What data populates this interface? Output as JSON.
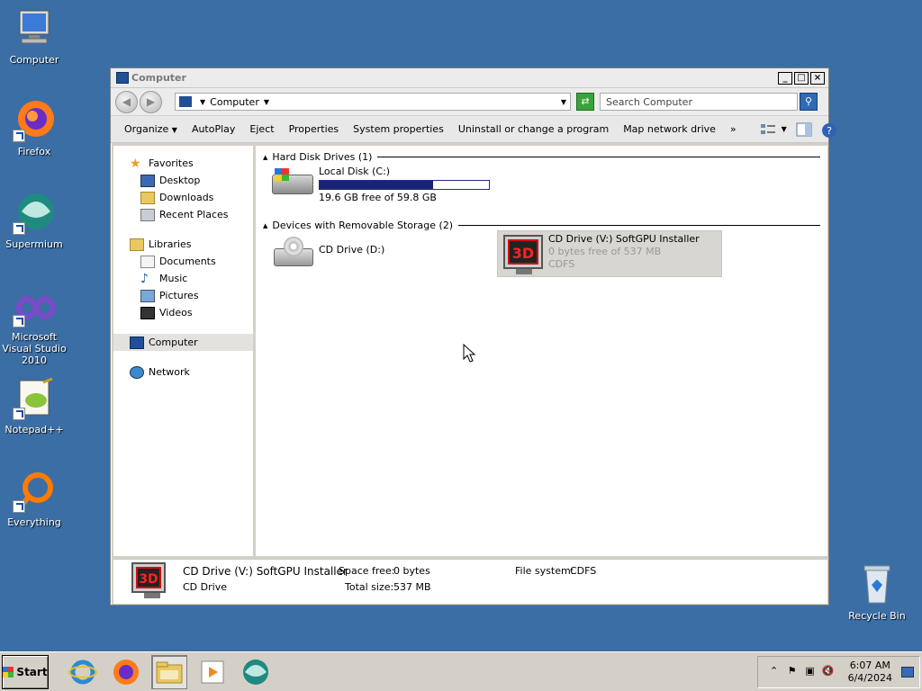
{
  "desktop": {
    "icons": [
      {
        "label": "Computer"
      },
      {
        "label": "Firefox"
      },
      {
        "label": "Supermium"
      },
      {
        "label": "Microsoft Visual Studio 2010"
      },
      {
        "label": "Notepad++"
      },
      {
        "label": "Everything"
      },
      {
        "label": "Recycle Bin"
      }
    ]
  },
  "window": {
    "title": "Computer",
    "address": {
      "location": "Computer"
    },
    "search": {
      "placeholder": "Search Computer"
    },
    "toolbar": {
      "organize": "Organize",
      "autoplay": "AutoPlay",
      "eject": "Eject",
      "properties": "Properties",
      "system_properties": "System properties",
      "uninstall": "Uninstall or change a program",
      "map_drive": "Map network drive",
      "more": "»"
    },
    "nav": {
      "favorites": "Favorites",
      "desktop": "Desktop",
      "downloads": "Downloads",
      "recent": "Recent Places",
      "libraries": "Libraries",
      "documents": "Documents",
      "music": "Music",
      "pictures": "Pictures",
      "videos": "Videos",
      "computer": "Computer",
      "network": "Network"
    },
    "groups": {
      "hdd": "Hard Disk Drives (1)",
      "removable": "Devices with Removable Storage (2)"
    },
    "drives": {
      "c": {
        "name": "Local Disk (C:)",
        "free": "19.6 GB free of 59.8 GB",
        "used_fraction": 0.672
      },
      "d": {
        "name": "CD Drive (D:)"
      },
      "v": {
        "name": "CD Drive (V:) SoftGPU Installer",
        "free": "0 bytes free of 537 MB",
        "fs": "CDFS"
      }
    },
    "details": {
      "name": "CD Drive (V:) SoftGPU Installer",
      "type": "CD Drive",
      "space_free_label": "Space free:",
      "space_free": "0 bytes",
      "total_size_label": "Total size:",
      "total_size": "537 MB",
      "fs_label": "File system:",
      "fs": "CDFS"
    }
  },
  "taskbar": {
    "start": "Start",
    "time": "6:07 AM",
    "date": "6/4/2024"
  }
}
